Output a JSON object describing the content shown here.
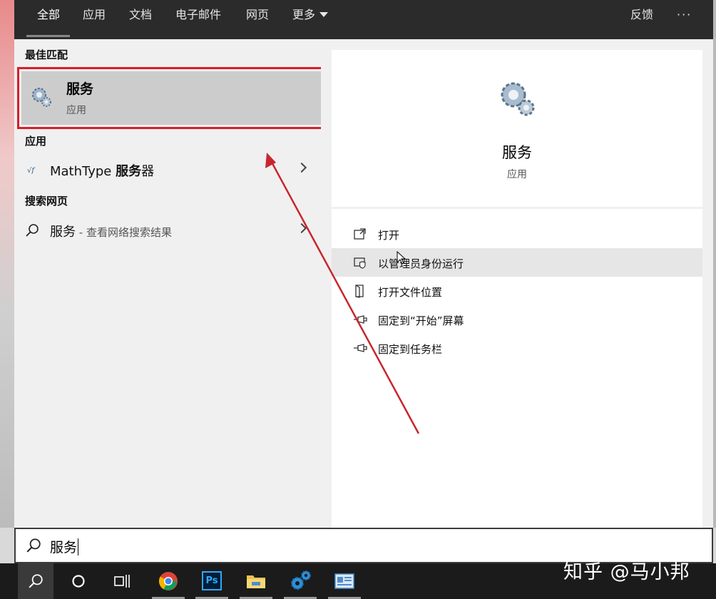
{
  "tabs": {
    "all": "全部",
    "apps": "应用",
    "docs": "文档",
    "email": "电子邮件",
    "web": "网页",
    "more": "更多",
    "feedback": "反馈",
    "ellipsis": "···"
  },
  "left": {
    "best_match_header": "最佳匹配",
    "best_match": {
      "title": "服务",
      "subtitle": "应用",
      "icon": "gears-icon"
    },
    "apps_header": "应用",
    "app_item": {
      "label_prefix": "MathType ",
      "label_bold": "服务",
      "label_suffix": "器",
      "icon": "mathtype-icon"
    },
    "web_header": "搜索网页",
    "web_item": {
      "label": "服务",
      "sub": " - 查看网络搜索结果",
      "icon": "search-icon"
    }
  },
  "detail": {
    "title": "服务",
    "subtitle": "应用",
    "icon": "gears-icon",
    "actions": [
      {
        "label": "打开",
        "icon": "open-icon"
      },
      {
        "label": "以管理员身份运行",
        "icon": "admin-shield-icon"
      },
      {
        "label": "打开文件位置",
        "icon": "file-location-icon"
      },
      {
        "label": "固定到“开始”屏幕",
        "icon": "pin-icon"
      },
      {
        "label": "固定到任务栏",
        "icon": "pin-icon"
      }
    ]
  },
  "search": {
    "value": "服务"
  },
  "taskbar": {
    "items": [
      "search-icon",
      "cortana-icon",
      "task-view-icon",
      "chrome-icon",
      "photoshop-icon",
      "file-explorer-icon",
      "services-gears-icon",
      "control-panel-icon"
    ],
    "photoshop_label": "Ps"
  },
  "watermark": "知乎 @马小邦",
  "colors": {
    "highlight_border": "#d81e2a",
    "arrow": "#c8262c",
    "topbar": "#2b2b2b",
    "taskbar": "#1b1b1b"
  }
}
